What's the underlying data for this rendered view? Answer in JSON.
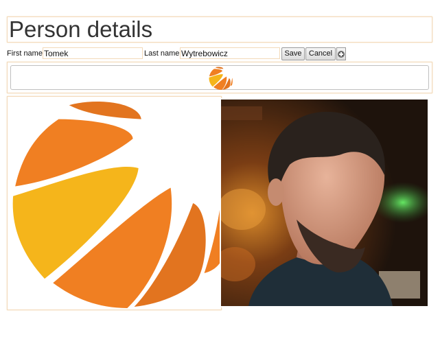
{
  "header": {
    "title": "Person details"
  },
  "form": {
    "first_name_label": "First name:",
    "first_name_value": "Tomek",
    "last_name_label": "Last name:",
    "last_name_value": "Wytrebowicz",
    "save_label": "Save",
    "cancel_label": "Cancel",
    "add_icon": "plus-circle-icon"
  },
  "colors": {
    "panel_border": "#f3d9b8",
    "logo_orange": "#f07f22",
    "logo_yellow": "#f5b51b",
    "logo_dark_orange": "#e2741f"
  },
  "images": {
    "logo": "orange-sphere-logo",
    "photo": "bearded-man-portrait-photo"
  }
}
